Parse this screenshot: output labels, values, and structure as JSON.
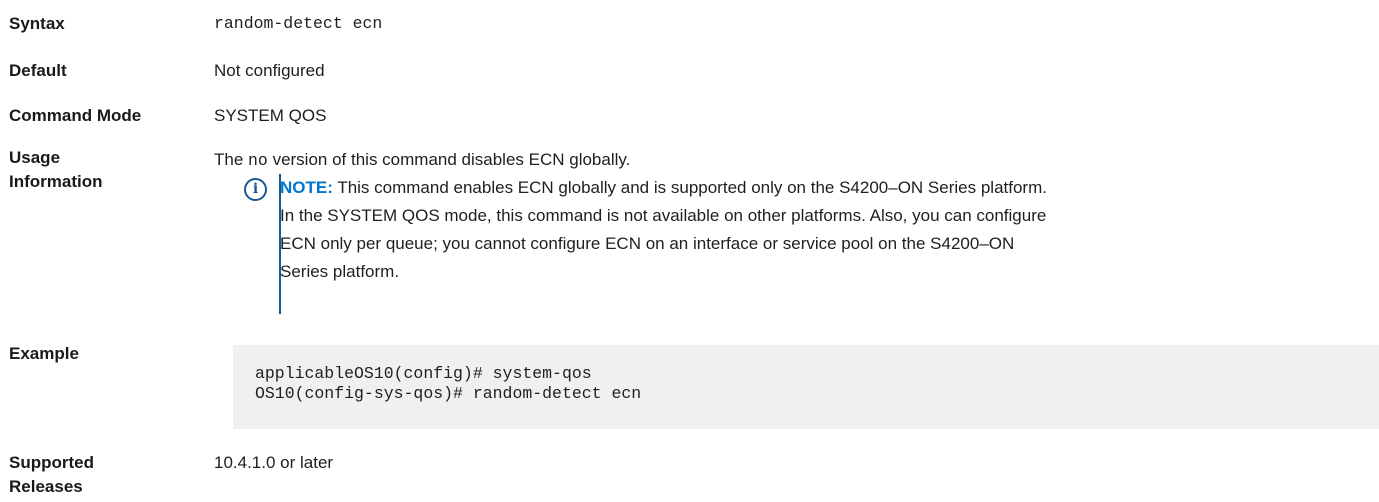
{
  "syntax": {
    "label": "Syntax",
    "value": "random-detect ecn"
  },
  "default": {
    "label": "Default",
    "value": "Not configured"
  },
  "command_mode": {
    "label": "Command Mode",
    "value": "SYSTEM QOS"
  },
  "usage": {
    "label_line1": "Usage",
    "label_line2": "Information",
    "text_before": "The ",
    "text_code": "no",
    "text_after": " version of this command disables ECN globally.",
    "note": {
      "icon": "info-icon",
      "heading": "NOTE:",
      "line1": "This command enables ECN globally and is supported only on the S4200–ON Series platform.",
      "line2": "In the SYSTEM QOS mode, this command is not available on other platforms. Also, you can configure",
      "line3": "ECN only per queue; you cannot configure ECN on an interface or service pool on the S4200–ON",
      "line4": "Series platform."
    }
  },
  "example": {
    "label": "Example",
    "code_line1": "applicableOS10(config)# system-qos",
    "code_line2": "OS10(config-sys-qos)# random-detect ecn"
  },
  "supported_releases": {
    "label_line1": "Supported",
    "label_line2": "Releases",
    "value": "10.4.1.0 or later"
  },
  "colors": {
    "note_accent": "#0076ce",
    "note_bar": "#1b5a91",
    "code_background": "#f0f0f0"
  }
}
